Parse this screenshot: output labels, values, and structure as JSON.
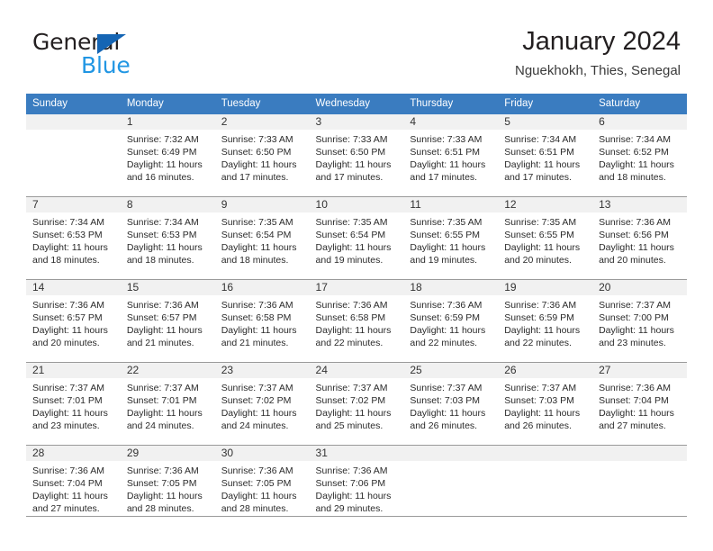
{
  "brand": {
    "name_part1": "General",
    "name_part2": "Blue",
    "triangle_icon": "triangle-icon",
    "color_dark": "#231f20",
    "color_blue": "#2196e3",
    "color_triangle": "#1565b4"
  },
  "header": {
    "title": "January 2024",
    "subtitle": "Nguekhokh, Thies, Senegal"
  },
  "theme": {
    "header_row_bg": "#3a7cc0",
    "daynum_bg": "#f1f1f1",
    "grid_line": "#9a9a9a",
    "text": "#2a2a2a"
  },
  "weekdays": [
    "Sunday",
    "Monday",
    "Tuesday",
    "Wednesday",
    "Thursday",
    "Friday",
    "Saturday"
  ],
  "weeks": [
    [
      {
        "day": "",
        "sunrise": "",
        "sunset": "",
        "daylight_line1": "",
        "daylight_line2": ""
      },
      {
        "day": "1",
        "sunrise": "Sunrise: 7:32 AM",
        "sunset": "Sunset: 6:49 PM",
        "daylight_line1": "Daylight: 11 hours",
        "daylight_line2": "and 16 minutes."
      },
      {
        "day": "2",
        "sunrise": "Sunrise: 7:33 AM",
        "sunset": "Sunset: 6:50 PM",
        "daylight_line1": "Daylight: 11 hours",
        "daylight_line2": "and 17 minutes."
      },
      {
        "day": "3",
        "sunrise": "Sunrise: 7:33 AM",
        "sunset": "Sunset: 6:50 PM",
        "daylight_line1": "Daylight: 11 hours",
        "daylight_line2": "and 17 minutes."
      },
      {
        "day": "4",
        "sunrise": "Sunrise: 7:33 AM",
        "sunset": "Sunset: 6:51 PM",
        "daylight_line1": "Daylight: 11 hours",
        "daylight_line2": "and 17 minutes."
      },
      {
        "day": "5",
        "sunrise": "Sunrise: 7:34 AM",
        "sunset": "Sunset: 6:51 PM",
        "daylight_line1": "Daylight: 11 hours",
        "daylight_line2": "and 17 minutes."
      },
      {
        "day": "6",
        "sunrise": "Sunrise: 7:34 AM",
        "sunset": "Sunset: 6:52 PM",
        "daylight_line1": "Daylight: 11 hours",
        "daylight_line2": "and 18 minutes."
      }
    ],
    [
      {
        "day": "7",
        "sunrise": "Sunrise: 7:34 AM",
        "sunset": "Sunset: 6:53 PM",
        "daylight_line1": "Daylight: 11 hours",
        "daylight_line2": "and 18 minutes."
      },
      {
        "day": "8",
        "sunrise": "Sunrise: 7:34 AM",
        "sunset": "Sunset: 6:53 PM",
        "daylight_line1": "Daylight: 11 hours",
        "daylight_line2": "and 18 minutes."
      },
      {
        "day": "9",
        "sunrise": "Sunrise: 7:35 AM",
        "sunset": "Sunset: 6:54 PM",
        "daylight_line1": "Daylight: 11 hours",
        "daylight_line2": "and 18 minutes."
      },
      {
        "day": "10",
        "sunrise": "Sunrise: 7:35 AM",
        "sunset": "Sunset: 6:54 PM",
        "daylight_line1": "Daylight: 11 hours",
        "daylight_line2": "and 19 minutes."
      },
      {
        "day": "11",
        "sunrise": "Sunrise: 7:35 AM",
        "sunset": "Sunset: 6:55 PM",
        "daylight_line1": "Daylight: 11 hours",
        "daylight_line2": "and 19 minutes."
      },
      {
        "day": "12",
        "sunrise": "Sunrise: 7:35 AM",
        "sunset": "Sunset: 6:55 PM",
        "daylight_line1": "Daylight: 11 hours",
        "daylight_line2": "and 20 minutes."
      },
      {
        "day": "13",
        "sunrise": "Sunrise: 7:36 AM",
        "sunset": "Sunset: 6:56 PM",
        "daylight_line1": "Daylight: 11 hours",
        "daylight_line2": "and 20 minutes."
      }
    ],
    [
      {
        "day": "14",
        "sunrise": "Sunrise: 7:36 AM",
        "sunset": "Sunset: 6:57 PM",
        "daylight_line1": "Daylight: 11 hours",
        "daylight_line2": "and 20 minutes."
      },
      {
        "day": "15",
        "sunrise": "Sunrise: 7:36 AM",
        "sunset": "Sunset: 6:57 PM",
        "daylight_line1": "Daylight: 11 hours",
        "daylight_line2": "and 21 minutes."
      },
      {
        "day": "16",
        "sunrise": "Sunrise: 7:36 AM",
        "sunset": "Sunset: 6:58 PM",
        "daylight_line1": "Daylight: 11 hours",
        "daylight_line2": "and 21 minutes."
      },
      {
        "day": "17",
        "sunrise": "Sunrise: 7:36 AM",
        "sunset": "Sunset: 6:58 PM",
        "daylight_line1": "Daylight: 11 hours",
        "daylight_line2": "and 22 minutes."
      },
      {
        "day": "18",
        "sunrise": "Sunrise: 7:36 AM",
        "sunset": "Sunset: 6:59 PM",
        "daylight_line1": "Daylight: 11 hours",
        "daylight_line2": "and 22 minutes."
      },
      {
        "day": "19",
        "sunrise": "Sunrise: 7:36 AM",
        "sunset": "Sunset: 6:59 PM",
        "daylight_line1": "Daylight: 11 hours",
        "daylight_line2": "and 22 minutes."
      },
      {
        "day": "20",
        "sunrise": "Sunrise: 7:37 AM",
        "sunset": "Sunset: 7:00 PM",
        "daylight_line1": "Daylight: 11 hours",
        "daylight_line2": "and 23 minutes."
      }
    ],
    [
      {
        "day": "21",
        "sunrise": "Sunrise: 7:37 AM",
        "sunset": "Sunset: 7:01 PM",
        "daylight_line1": "Daylight: 11 hours",
        "daylight_line2": "and 23 minutes."
      },
      {
        "day": "22",
        "sunrise": "Sunrise: 7:37 AM",
        "sunset": "Sunset: 7:01 PM",
        "daylight_line1": "Daylight: 11 hours",
        "daylight_line2": "and 24 minutes."
      },
      {
        "day": "23",
        "sunrise": "Sunrise: 7:37 AM",
        "sunset": "Sunset: 7:02 PM",
        "daylight_line1": "Daylight: 11 hours",
        "daylight_line2": "and 24 minutes."
      },
      {
        "day": "24",
        "sunrise": "Sunrise: 7:37 AM",
        "sunset": "Sunset: 7:02 PM",
        "daylight_line1": "Daylight: 11 hours",
        "daylight_line2": "and 25 minutes."
      },
      {
        "day": "25",
        "sunrise": "Sunrise: 7:37 AM",
        "sunset": "Sunset: 7:03 PM",
        "daylight_line1": "Daylight: 11 hours",
        "daylight_line2": "and 26 minutes."
      },
      {
        "day": "26",
        "sunrise": "Sunrise: 7:37 AM",
        "sunset": "Sunset: 7:03 PM",
        "daylight_line1": "Daylight: 11 hours",
        "daylight_line2": "and 26 minutes."
      },
      {
        "day": "27",
        "sunrise": "Sunrise: 7:36 AM",
        "sunset": "Sunset: 7:04 PM",
        "daylight_line1": "Daylight: 11 hours",
        "daylight_line2": "and 27 minutes."
      }
    ],
    [
      {
        "day": "28",
        "sunrise": "Sunrise: 7:36 AM",
        "sunset": "Sunset: 7:04 PM",
        "daylight_line1": "Daylight: 11 hours",
        "daylight_line2": "and 27 minutes."
      },
      {
        "day": "29",
        "sunrise": "Sunrise: 7:36 AM",
        "sunset": "Sunset: 7:05 PM",
        "daylight_line1": "Daylight: 11 hours",
        "daylight_line2": "and 28 minutes."
      },
      {
        "day": "30",
        "sunrise": "Sunrise: 7:36 AM",
        "sunset": "Sunset: 7:05 PM",
        "daylight_line1": "Daylight: 11 hours",
        "daylight_line2": "and 28 minutes."
      },
      {
        "day": "31",
        "sunrise": "Sunrise: 7:36 AM",
        "sunset": "Sunset: 7:06 PM",
        "daylight_line1": "Daylight: 11 hours",
        "daylight_line2": "and 29 minutes."
      },
      {
        "day": "",
        "sunrise": "",
        "sunset": "",
        "daylight_line1": "",
        "daylight_line2": ""
      },
      {
        "day": "",
        "sunrise": "",
        "sunset": "",
        "daylight_line1": "",
        "daylight_line2": ""
      },
      {
        "day": "",
        "sunrise": "",
        "sunset": "",
        "daylight_line1": "",
        "daylight_line2": ""
      }
    ]
  ]
}
